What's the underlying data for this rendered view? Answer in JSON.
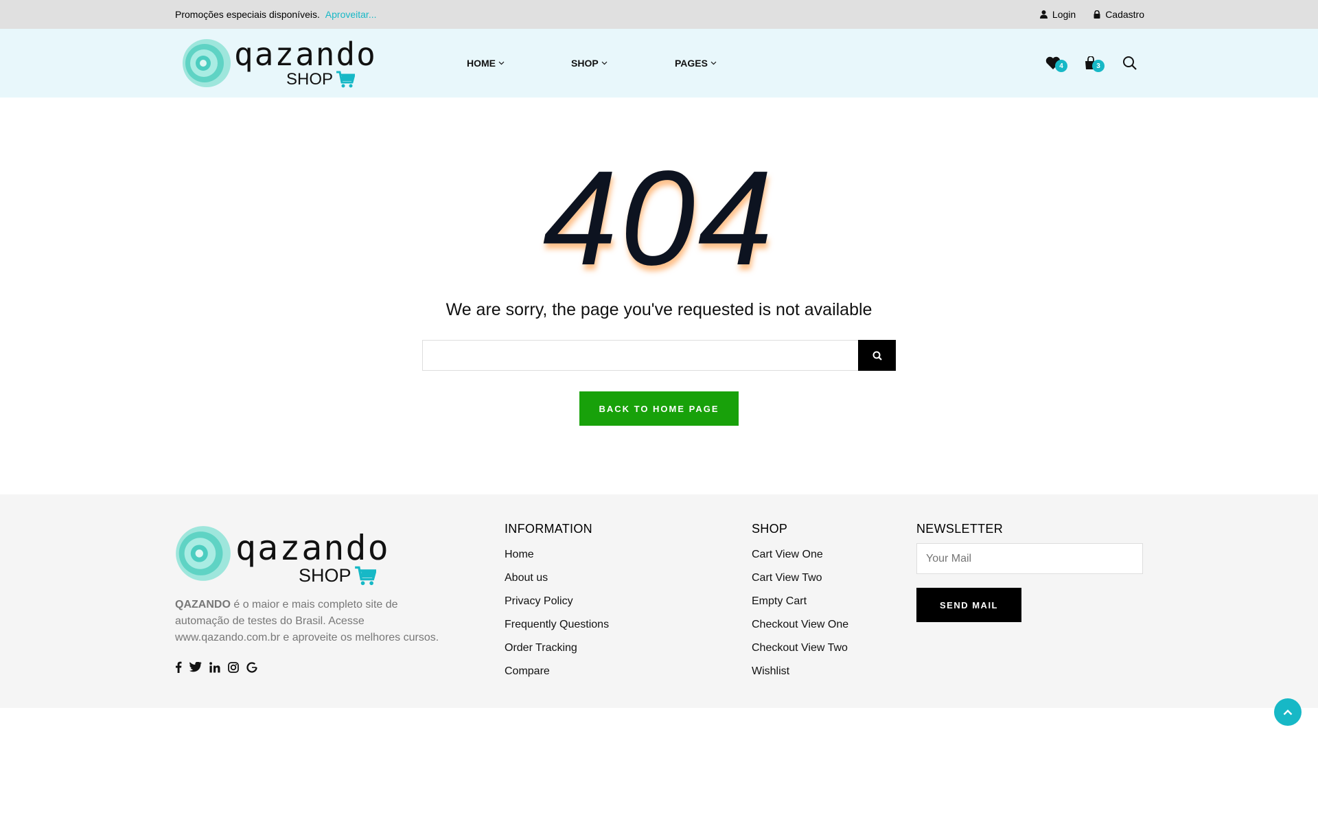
{
  "topbar": {
    "promo_text": "Promoções especiais disponíveis.",
    "promo_link": "Aproveitar...",
    "login": "Login",
    "signup": "Cadastro"
  },
  "logo": {
    "name": "qazando",
    "sub": "SHOP"
  },
  "nav": {
    "home": "HOME",
    "shop": "SHOP",
    "pages": "PAGES"
  },
  "header_icons": {
    "wishlist_count": "4",
    "cart_count": "3"
  },
  "error": {
    "code": "404",
    "message": "We are sorry, the page you've requested is not available",
    "search_value": "",
    "back_button": "BACK TO HOME PAGE"
  },
  "footer": {
    "brand": "QAZANDO",
    "desc": "é o maior e mais completo site de automação de testes do Brasil. Acesse www.qazando.com.br e aproveite os melhores cursos.",
    "information": {
      "title": "INFORMATION",
      "links": [
        "Home",
        "About us",
        "Privacy Policy",
        "Frequently Questions",
        "Order Tracking",
        "Compare"
      ]
    },
    "shop": {
      "title": "SHOP",
      "links": [
        "Cart View One",
        "Cart View Two",
        "Empty Cart",
        "Checkout View One",
        "Checkout View Two",
        "Wishlist"
      ]
    },
    "newsletter": {
      "title": "NEWSLETTER",
      "placeholder": "Your Mail",
      "button": "SEND MAIL"
    }
  },
  "colors": {
    "accent": "#17b8c6",
    "green": "#18a10a",
    "topbar": "#e0e0e0",
    "header": "#e8f7fb",
    "footer": "#f5f5f5"
  }
}
